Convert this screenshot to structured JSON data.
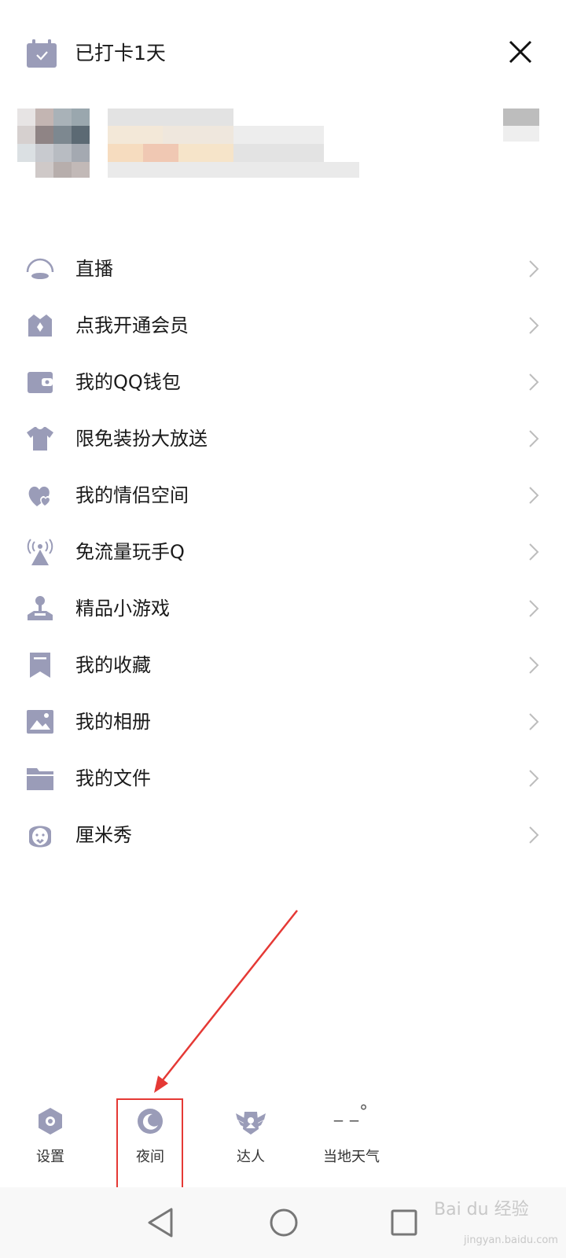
{
  "header": {
    "checkin_label": "已打卡1天",
    "icons": {
      "checkin": "calendar-check-icon",
      "close": "close-icon"
    }
  },
  "menu": {
    "items": [
      {
        "label": "直播",
        "icon": "live-icon"
      },
      {
        "label": "点我开通会员",
        "icon": "crown-icon"
      },
      {
        "label": "我的QQ钱包",
        "icon": "wallet-icon"
      },
      {
        "label": "限免装扮大放送",
        "icon": "shirt-icon"
      },
      {
        "label": "我的情侣空间",
        "icon": "hearts-icon"
      },
      {
        "label": "免流量玩手Q",
        "icon": "signal-tower-icon"
      },
      {
        "label": "精品小游戏",
        "icon": "joystick-icon"
      },
      {
        "label": "我的收藏",
        "icon": "bookmark-icon"
      },
      {
        "label": "我的相册",
        "icon": "photo-icon"
      },
      {
        "label": "我的文件",
        "icon": "folder-icon"
      },
      {
        "label": "厘米秀",
        "icon": "cmshow-face-icon"
      }
    ]
  },
  "bottom_tabs": [
    {
      "label": "设置",
      "icon": "settings-hex-icon"
    },
    {
      "label": "夜间",
      "icon": "moon-icon"
    },
    {
      "label": "达人",
      "icon": "winged-badge-icon"
    },
    {
      "label": "当地天气",
      "icon": "weather-placeholder",
      "reading": "_ _°"
    }
  ],
  "watermark": {
    "text": "Bai du 经验",
    "sub": "jingyan.baidu.com"
  },
  "colors": {
    "icon": "#9a9cb8",
    "highlight": "#e53935",
    "text": "#1a1a1a"
  }
}
